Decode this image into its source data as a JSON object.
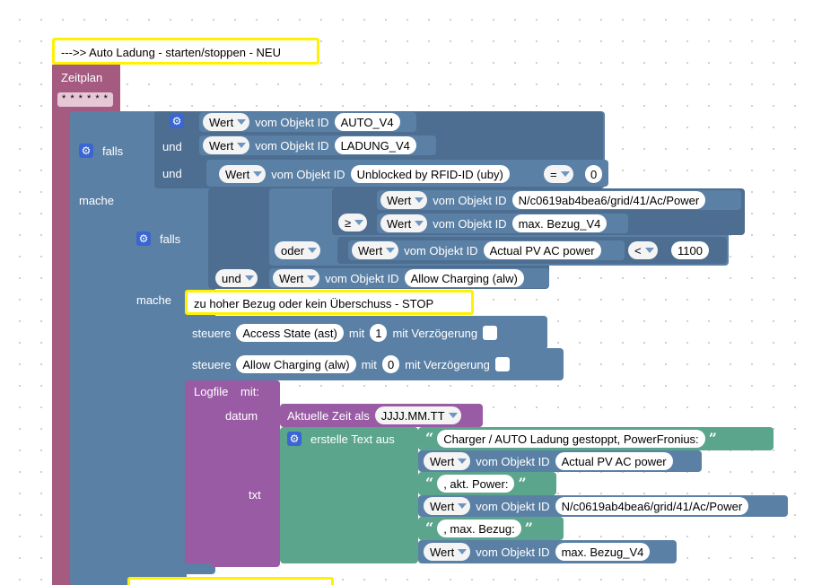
{
  "header_comment": "--->> Auto Ladung - starten/stoppen - NEU",
  "schedule": {
    "label": "Zeitplan",
    "cron": "* * * * * *"
  },
  "outer_if": {
    "if_label": "falls",
    "do_label": "mache",
    "and1": "und",
    "and2": "und",
    "cond1": {
      "attr": "Wert",
      "of_object": "vom Objekt ID",
      "object": "AUTO_V4"
    },
    "cond2": {
      "attr": "Wert",
      "of_object": "vom Objekt ID",
      "object": "LADUNG_V4"
    },
    "cond3": {
      "attr": "Wert",
      "of_object": "vom Objekt ID",
      "object": "Unblocked by RFID-ID (uby)",
      "op": "=",
      "value": "0"
    }
  },
  "inner_if": {
    "if_label": "falls",
    "do_label": "mache",
    "and_op": "und",
    "or_op": "oder",
    "ge_op": "≥",
    "lt_op": "<",
    "grid": {
      "attr": "Wert",
      "of_object": "vom Objekt ID",
      "object": "N/c0619ab4bea6/grid/41/Ac/Power"
    },
    "maxbezug": {
      "attr": "Wert",
      "of_object": "vom Objekt ID",
      "object": "max. Bezug_V4"
    },
    "pv": {
      "attr": "Wert",
      "of_object": "vom Objekt ID",
      "object": "Actual PV AC power",
      "value": "1100"
    },
    "allow": {
      "attr": "Wert",
      "of_object": "vom Objekt ID",
      "object": "Allow Charging (alw)"
    }
  },
  "do_body": {
    "comment": "zu hoher Bezug oder kein Überschuss - STOP",
    "set1": {
      "label": "steuere",
      "object": "Access State (ast)",
      "with": "mit",
      "value": "1",
      "delay": "mit Verzögerung"
    },
    "set2": {
      "label": "steuere",
      "object": "Allow Charging (alw)",
      "with": "mit",
      "value": "0",
      "delay": "mit Verzögerung"
    },
    "log": {
      "label": "Logfile",
      "with": "mit:",
      "date_label": "datum",
      "date_block": "Aktuelle Zeit als",
      "date_format": "JJJJ.MM.TT",
      "txt_label": "txt",
      "create_text": "erstelle Text aus",
      "parts": {
        "t1": "Charger / AUTO Ladung gestoppt, PowerFronius:",
        "v1": {
          "attr": "Wert",
          "of_object": "vom Objekt ID",
          "object": "Actual PV AC power"
        },
        "t2": ", akt. Power:",
        "v2": {
          "attr": "Wert",
          "of_object": "vom Objekt ID",
          "object": "N/c0619ab4bea6/grid/41/Ac/Power"
        },
        "t3": ", max. Bezug:",
        "v3": {
          "attr": "Wert",
          "of_object": "vom Objekt ID",
          "object": "max. Bezug_V4"
        }
      }
    }
  },
  "quote_open": "“",
  "quote_close": "”",
  "colors": {
    "schedule": "#a55b80",
    "logic": "#5b80a5",
    "system": "#9a5ba5",
    "text": "#5ba58c",
    "comment_border": "#fff200",
    "mutator": "#3a66d2"
  }
}
